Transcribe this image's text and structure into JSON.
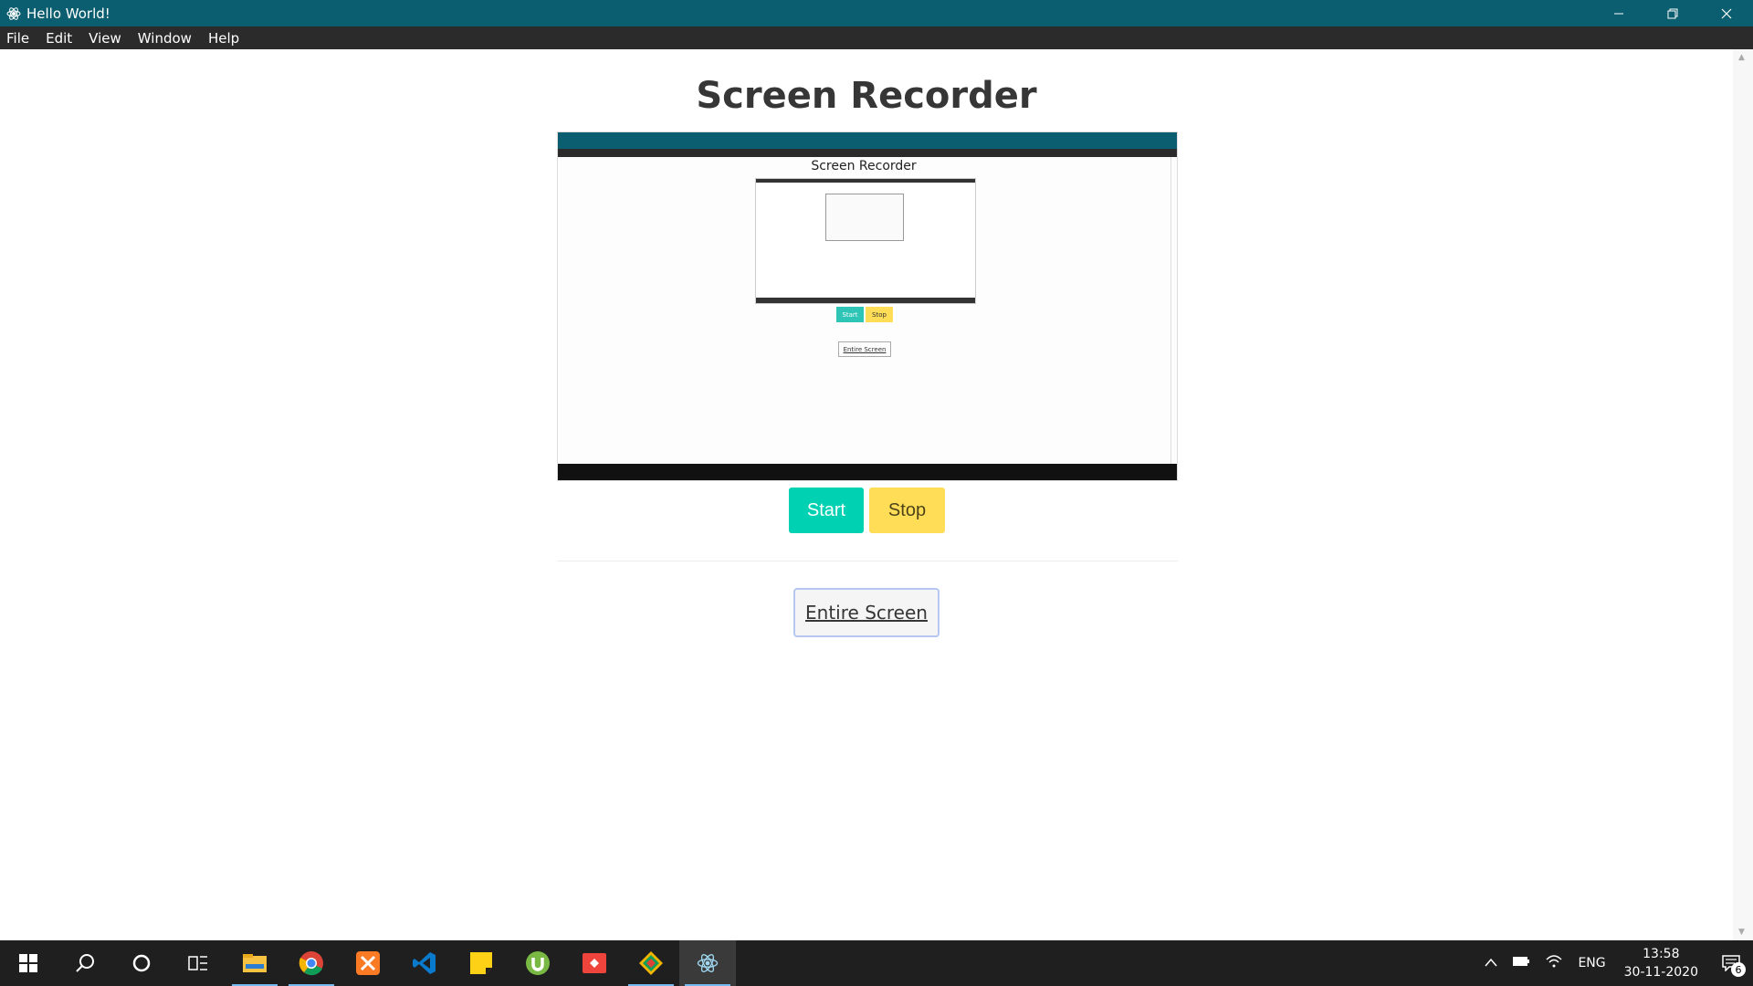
{
  "window": {
    "title": "Hello World!",
    "menu": [
      "File",
      "Edit",
      "View",
      "Window",
      "Help"
    ]
  },
  "page": {
    "heading": "Screen Recorder",
    "start_label": "Start",
    "stop_label": "Stop",
    "source_label": "Entire Screen"
  },
  "preview": {
    "heading": "Screen Recorder",
    "start_label": "Start",
    "stop_label": "Stop",
    "source_label": "Entire Screen"
  },
  "taskbar": {
    "apps": [
      "start-icon",
      "search-icon",
      "cortana-icon",
      "task-view-icon",
      "file-explorer-icon",
      "chrome-icon",
      "xampp-icon",
      "vscode-icon",
      "sticky-notes-icon",
      "utorrent-icon",
      "anydesk-icon",
      "git-kraken-icon",
      "electron-icon"
    ],
    "language": "ENG",
    "time": "13:58",
    "date": "30-11-2020",
    "notification_count": "6"
  },
  "colors": {
    "titlebar": "#0b5e6f",
    "start": "#00d1b2",
    "stop": "#ffdd57"
  }
}
